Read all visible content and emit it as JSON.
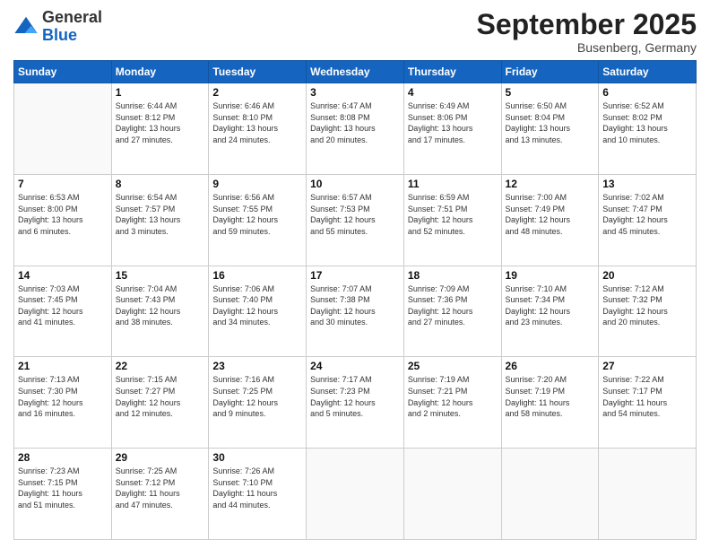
{
  "logo": {
    "general": "General",
    "blue": "Blue"
  },
  "header": {
    "month": "September 2025",
    "location": "Busenberg, Germany"
  },
  "weekdays": [
    "Sunday",
    "Monday",
    "Tuesday",
    "Wednesday",
    "Thursday",
    "Friday",
    "Saturday"
  ],
  "weeks": [
    [
      {
        "day": "",
        "info": ""
      },
      {
        "day": "1",
        "info": "Sunrise: 6:44 AM\nSunset: 8:12 PM\nDaylight: 13 hours\nand 27 minutes."
      },
      {
        "day": "2",
        "info": "Sunrise: 6:46 AM\nSunset: 8:10 PM\nDaylight: 13 hours\nand 24 minutes."
      },
      {
        "day": "3",
        "info": "Sunrise: 6:47 AM\nSunset: 8:08 PM\nDaylight: 13 hours\nand 20 minutes."
      },
      {
        "day": "4",
        "info": "Sunrise: 6:49 AM\nSunset: 8:06 PM\nDaylight: 13 hours\nand 17 minutes."
      },
      {
        "day": "5",
        "info": "Sunrise: 6:50 AM\nSunset: 8:04 PM\nDaylight: 13 hours\nand 13 minutes."
      },
      {
        "day": "6",
        "info": "Sunrise: 6:52 AM\nSunset: 8:02 PM\nDaylight: 13 hours\nand 10 minutes."
      }
    ],
    [
      {
        "day": "7",
        "info": "Sunrise: 6:53 AM\nSunset: 8:00 PM\nDaylight: 13 hours\nand 6 minutes."
      },
      {
        "day": "8",
        "info": "Sunrise: 6:54 AM\nSunset: 7:57 PM\nDaylight: 13 hours\nand 3 minutes."
      },
      {
        "day": "9",
        "info": "Sunrise: 6:56 AM\nSunset: 7:55 PM\nDaylight: 12 hours\nand 59 minutes."
      },
      {
        "day": "10",
        "info": "Sunrise: 6:57 AM\nSunset: 7:53 PM\nDaylight: 12 hours\nand 55 minutes."
      },
      {
        "day": "11",
        "info": "Sunrise: 6:59 AM\nSunset: 7:51 PM\nDaylight: 12 hours\nand 52 minutes."
      },
      {
        "day": "12",
        "info": "Sunrise: 7:00 AM\nSunset: 7:49 PM\nDaylight: 12 hours\nand 48 minutes."
      },
      {
        "day": "13",
        "info": "Sunrise: 7:02 AM\nSunset: 7:47 PM\nDaylight: 12 hours\nand 45 minutes."
      }
    ],
    [
      {
        "day": "14",
        "info": "Sunrise: 7:03 AM\nSunset: 7:45 PM\nDaylight: 12 hours\nand 41 minutes."
      },
      {
        "day": "15",
        "info": "Sunrise: 7:04 AM\nSunset: 7:43 PM\nDaylight: 12 hours\nand 38 minutes."
      },
      {
        "day": "16",
        "info": "Sunrise: 7:06 AM\nSunset: 7:40 PM\nDaylight: 12 hours\nand 34 minutes."
      },
      {
        "day": "17",
        "info": "Sunrise: 7:07 AM\nSunset: 7:38 PM\nDaylight: 12 hours\nand 30 minutes."
      },
      {
        "day": "18",
        "info": "Sunrise: 7:09 AM\nSunset: 7:36 PM\nDaylight: 12 hours\nand 27 minutes."
      },
      {
        "day": "19",
        "info": "Sunrise: 7:10 AM\nSunset: 7:34 PM\nDaylight: 12 hours\nand 23 minutes."
      },
      {
        "day": "20",
        "info": "Sunrise: 7:12 AM\nSunset: 7:32 PM\nDaylight: 12 hours\nand 20 minutes."
      }
    ],
    [
      {
        "day": "21",
        "info": "Sunrise: 7:13 AM\nSunset: 7:30 PM\nDaylight: 12 hours\nand 16 minutes."
      },
      {
        "day": "22",
        "info": "Sunrise: 7:15 AM\nSunset: 7:27 PM\nDaylight: 12 hours\nand 12 minutes."
      },
      {
        "day": "23",
        "info": "Sunrise: 7:16 AM\nSunset: 7:25 PM\nDaylight: 12 hours\nand 9 minutes."
      },
      {
        "day": "24",
        "info": "Sunrise: 7:17 AM\nSunset: 7:23 PM\nDaylight: 12 hours\nand 5 minutes."
      },
      {
        "day": "25",
        "info": "Sunrise: 7:19 AM\nSunset: 7:21 PM\nDaylight: 12 hours\nand 2 minutes."
      },
      {
        "day": "26",
        "info": "Sunrise: 7:20 AM\nSunset: 7:19 PM\nDaylight: 11 hours\nand 58 minutes."
      },
      {
        "day": "27",
        "info": "Sunrise: 7:22 AM\nSunset: 7:17 PM\nDaylight: 11 hours\nand 54 minutes."
      }
    ],
    [
      {
        "day": "28",
        "info": "Sunrise: 7:23 AM\nSunset: 7:15 PM\nDaylight: 11 hours\nand 51 minutes."
      },
      {
        "day": "29",
        "info": "Sunrise: 7:25 AM\nSunset: 7:12 PM\nDaylight: 11 hours\nand 47 minutes."
      },
      {
        "day": "30",
        "info": "Sunrise: 7:26 AM\nSunset: 7:10 PM\nDaylight: 11 hours\nand 44 minutes."
      },
      {
        "day": "",
        "info": ""
      },
      {
        "day": "",
        "info": ""
      },
      {
        "day": "",
        "info": ""
      },
      {
        "day": "",
        "info": ""
      }
    ]
  ]
}
